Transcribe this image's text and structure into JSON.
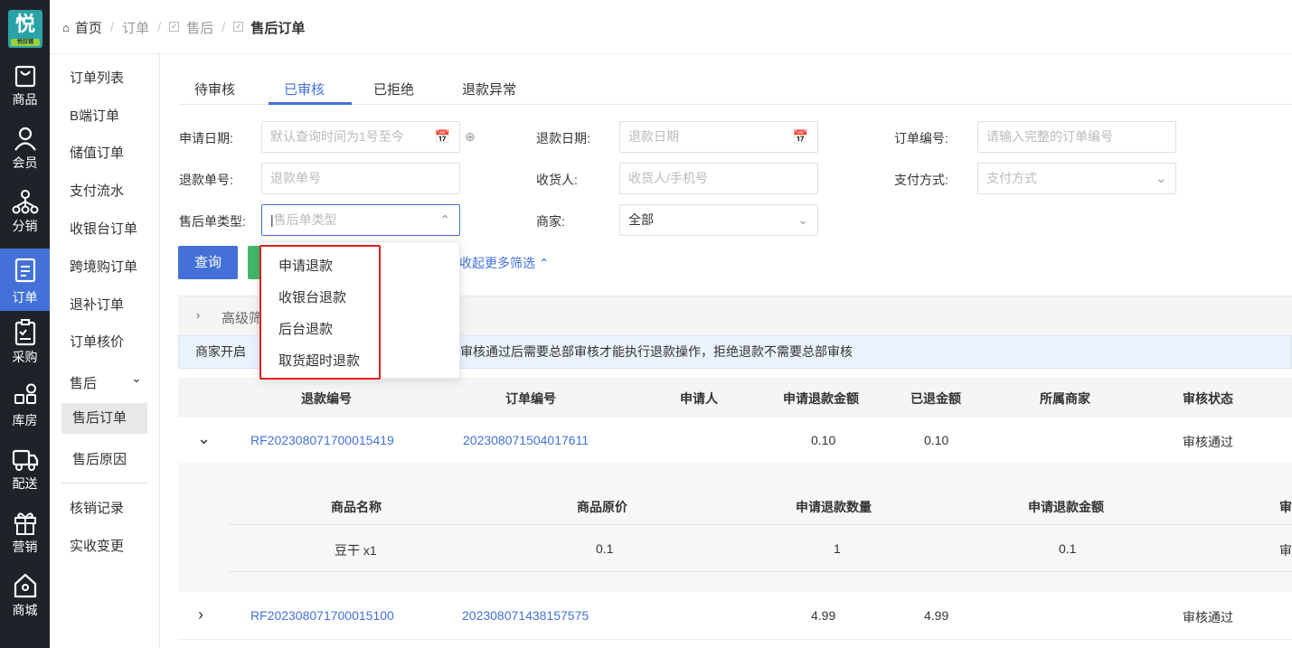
{
  "logo": {
    "main": "悦",
    "sub": "悦拉铺"
  },
  "rail": [
    {
      "label": "商品",
      "icon": "bag-icon"
    },
    {
      "label": "会员",
      "icon": "user-icon"
    },
    {
      "label": "分销",
      "icon": "network-icon"
    },
    {
      "label": "订单",
      "icon": "document-icon",
      "active": true
    },
    {
      "label": "采购",
      "icon": "clipboard-icon"
    },
    {
      "label": "库房",
      "icon": "grid-icon"
    },
    {
      "label": "配送",
      "icon": "truck-icon"
    },
    {
      "label": "营销",
      "icon": "gift-icon"
    },
    {
      "label": "商城",
      "icon": "house-icon"
    }
  ],
  "breadcrumb": {
    "home": "首页",
    "l1": "订单",
    "l2": "售后",
    "current": "售后订单"
  },
  "subnav": {
    "items": [
      "订单列表",
      "B端订单",
      "储值订单",
      "支付流水",
      "收银台订单",
      "跨境购订单",
      "退补订单",
      "订单核价"
    ],
    "group": "售后",
    "group_items": [
      "售后订单",
      "售后原因"
    ],
    "bottom_items": [
      "核销记录",
      "实收变更"
    ]
  },
  "tabs": [
    "待审核",
    "已审核",
    "已拒绝",
    "退款异常"
  ],
  "filters": {
    "apply_date": {
      "label": "申请日期:",
      "placeholder": "默认查询时间为1号至今"
    },
    "refund_date": {
      "label": "退款日期:",
      "placeholder": "退款日期"
    },
    "order_no": {
      "label": "订单编号:",
      "placeholder": "请输入完整的订单编号"
    },
    "refund_no": {
      "label": "退款单号:",
      "placeholder": "退款单号"
    },
    "consignee": {
      "label": "收货人:",
      "placeholder": "收货人/手机号"
    },
    "pay_method": {
      "label": "支付方式:",
      "placeholder": "支付方式"
    },
    "after_sale_type": {
      "label": "售后单类型:",
      "placeholder": "售后单类型"
    },
    "merchant": {
      "label": "商家:",
      "value": "全部"
    }
  },
  "buttons": {
    "query": "查询",
    "collapse": "收起更多筛选"
  },
  "advanced": {
    "label": "高级筛"
  },
  "notice": {
    "left": "商家开启",
    "right": "审核通过后需要总部审核才能执行退款操作，拒绝退款不需要总部审核"
  },
  "dropdown": {
    "options": [
      "申请退款",
      "收银台退款",
      "后台退款",
      "取货超时退款"
    ]
  },
  "table": {
    "columns": [
      "退款编号",
      "订单编号",
      "申请人",
      "申请退款金额",
      "已退金额",
      "所属商家",
      "审核状态"
    ],
    "rows": [
      {
        "refund_no": "RF202308071700015419",
        "order_no": "202308071504017611",
        "applicant": "",
        "apply_amount": "0.10",
        "refunded": "0.10",
        "merchant": "",
        "status": "审核通过",
        "expand": "⌄"
      },
      {
        "refund_no": "RF202308071700015100",
        "order_no": "202308071438157575",
        "applicant": "",
        "apply_amount": "4.99",
        "refunded": "4.99",
        "merchant": "",
        "status": "审核通过",
        "expand": "›"
      }
    ],
    "sub_columns": [
      "商品名称",
      "商品原价",
      "申请退款数量",
      "申请退款金额",
      "审"
    ],
    "sub_rows": [
      {
        "name": "豆干 x1",
        "price": "0.1",
        "qty": "1",
        "amount": "0.1",
        "status": "审"
      }
    ]
  }
}
